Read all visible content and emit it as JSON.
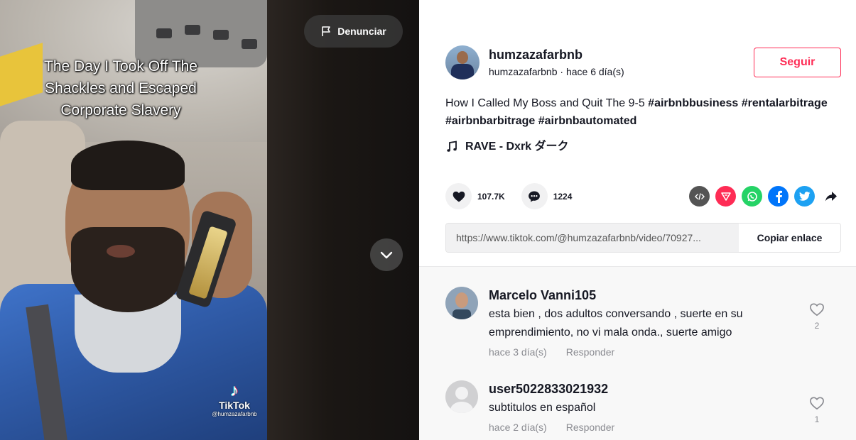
{
  "video": {
    "overlay_lines": [
      "The Day I Took Off The",
      "Shackles and Escaped",
      "Corporate Slavery"
    ],
    "watermark_brand": "TikTok",
    "watermark_handle": "@humzazafarbnb",
    "report_label": "Denunciar"
  },
  "author": {
    "display_name": "humzazafarbnb",
    "subtitle": "humzazafarbnb · hace 6 día(s)",
    "follow_label": "Seguir"
  },
  "post": {
    "description_text": "How I Called My Boss and Quit The 9-5 ",
    "hashtags": [
      "#airbnbbusiness",
      "#rentalarbitrage",
      "#airbnbarbitrage",
      "#airbnbautomated"
    ],
    "music": "RAVE - Dxrk ダーク"
  },
  "stats": {
    "likes": "107.7K",
    "comments": "1224"
  },
  "share": {
    "icons": [
      "embed-icon",
      "send-icon",
      "whatsapp-icon",
      "facebook-icon",
      "twitter-icon",
      "share-arrow-icon"
    ],
    "colors": {
      "embed": "#545454",
      "send": "#fe2c55",
      "whatsapp": "#25d366",
      "facebook": "#0075fa",
      "twitter": "#1da1f2"
    }
  },
  "link": {
    "url": "https://www.tiktok.com/@humzazafarbnb/video/70927...",
    "copy_label": "Copiar enlace"
  },
  "comments": [
    {
      "user": "Marcelo Vanni105",
      "text": "esta bien , dos adultos conversando , suerte en su emprendimiento, no vi mala onda., suerte amigo",
      "time": "hace 3 día(s)",
      "reply": "Responder",
      "likes": "2"
    },
    {
      "user": "user5022833021932",
      "text": "subtitulos en español",
      "time": "hace 2 día(s)",
      "reply": "Responder",
      "likes": "1"
    }
  ],
  "colors": {
    "accent": "#fe2c55",
    "text": "#161823",
    "muted": "#8a8b91"
  }
}
